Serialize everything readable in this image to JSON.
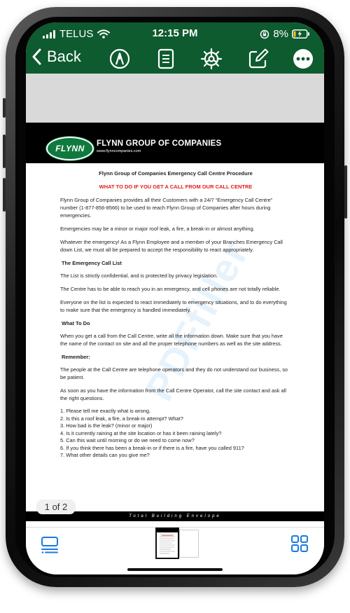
{
  "status_bar": {
    "carrier": "TELUS",
    "time": "12:15 PM",
    "battery_percent": "8%"
  },
  "toolbar": {
    "back_label": "Back",
    "icons": [
      "annotate-pen-icon",
      "document-icon",
      "settings-gear-icon",
      "edit-icon",
      "more-icon"
    ]
  },
  "document": {
    "company_name": "FLYNN GROUP OF COMPANIES",
    "website": "www.flynncompanies.com",
    "logo_text": "FLYNN",
    "title": "Flynn Group of Companies Emergency Call Centre Procedure",
    "subtitle": "WHAT TO DO IF YOU GET A CALL FROM OUR CALL CENTRE",
    "paragraphs_intro": [
      "Flynn Group of Companies provides all their Customers with a 24/7 “Emergency Call Centre” number (1-877-856-8566) to be used to reach Flynn Group of Companies after hours during emergencies.",
      "Emergencies may be a minor or major roof leak, a fire, a break-in or almost anything.",
      "Whatever the emergency! As a Flynn Employee and a member of your Branches Emergency Call down List, we must all be prepared to accept the responsibility to react appropriately."
    ],
    "heading_call_list": "The Emergency Call List",
    "paragraphs_call_list": [
      "The List is strictly confidential, and is protected by privacy legislation.",
      "The Centre has to be able to reach you in an emergency, and cell phones are not totally reliable.",
      "Everyone on the list is expected to react immediately to emergency situations, and to do everything to make sure that the emergency is handled immediately."
    ],
    "heading_what_to_do": "What To Do",
    "paragraph_what_to_do": "When you get a call from the Call Centre, write all the information down. Make sure that you have the name of the contact on site and all the proper telephone numbers as well as the site address.",
    "heading_remember": "Remember:",
    "paragraphs_remember": [
      "The people at the Call Centre are telephone operators and they do not understand our business, so be patient.",
      "As soon as you have the information from the Call Centre Operator, call the site contact and ask all the right questions."
    ],
    "questions": [
      "1. Please tell me exactly what is wrong.",
      "2. Is this a roof leak, a fire, a break-in attempt? What?",
      "3. How bad is the leak? (minor or major)",
      "4. Is it currently raining at the site location or has it been raining lately?",
      "5. Can this wait until morning or do we need to come now?",
      "6. If you think there has been a break-in or if there is a fire, have you called 911?",
      "7. What other details can you give me?"
    ],
    "footer_tagline": "Total Building Envelope"
  },
  "page_indicator": "1 of 2",
  "bottom_bar": {
    "icons": [
      "thumbnails-list-icon",
      "grid-view-icon"
    ]
  },
  "colors": {
    "header_green": "#0d5b2f",
    "accent_blue": "#1a7ae0",
    "subtitle_red": "#e21b1b"
  }
}
